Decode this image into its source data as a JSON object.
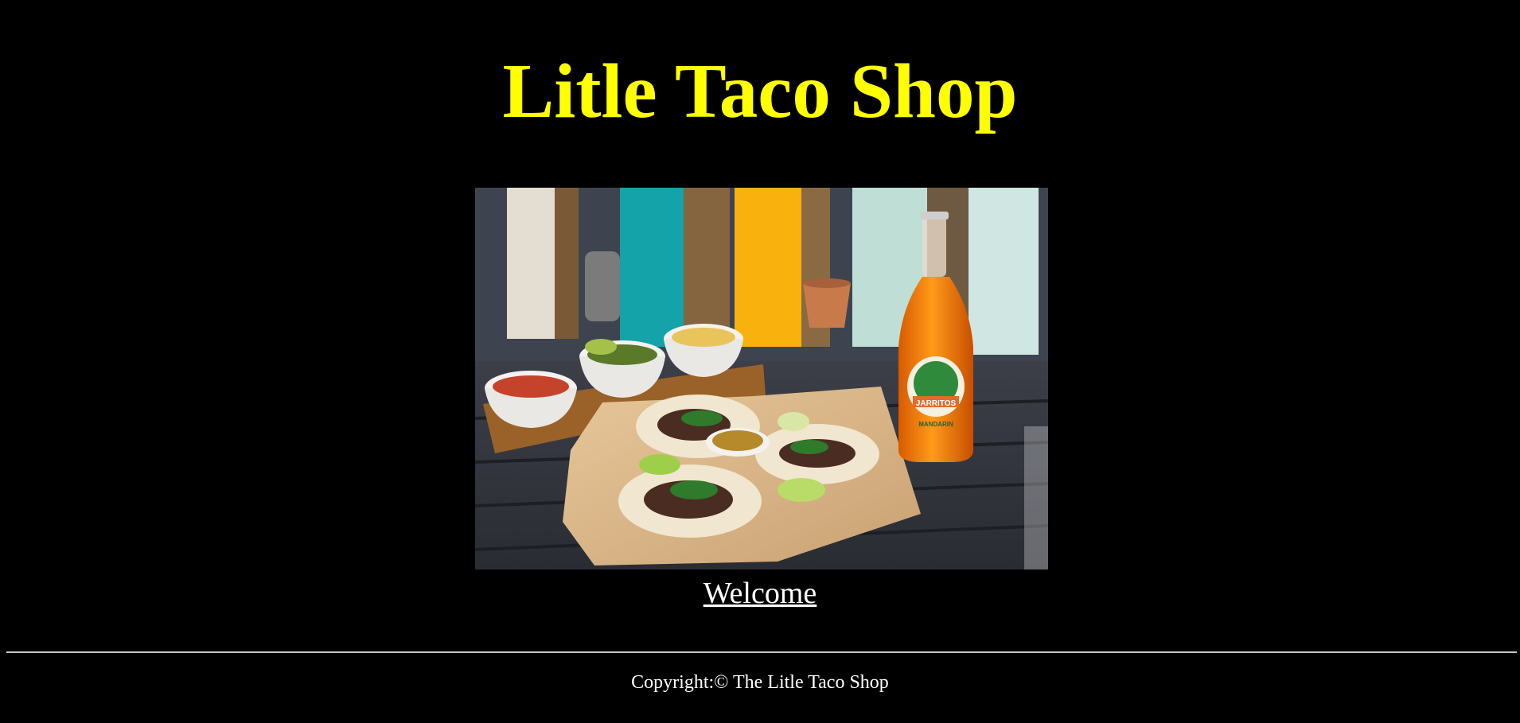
{
  "header": {
    "title": "Litle Taco Shop"
  },
  "hero": {
    "alt": "Tacos, salsa bowls and a bottle of Jarritos Mandarin on a table",
    "bottle_brand": "JARRITOS",
    "bottle_flavor": "MANDARIN"
  },
  "nav": {
    "welcome_label": "Welcome"
  },
  "footer": {
    "copyright": "Copyright:© The Litle Taco Shop"
  },
  "colors": {
    "background": "#000000",
    "title": "#ffff00",
    "text": "#ffffff"
  }
}
